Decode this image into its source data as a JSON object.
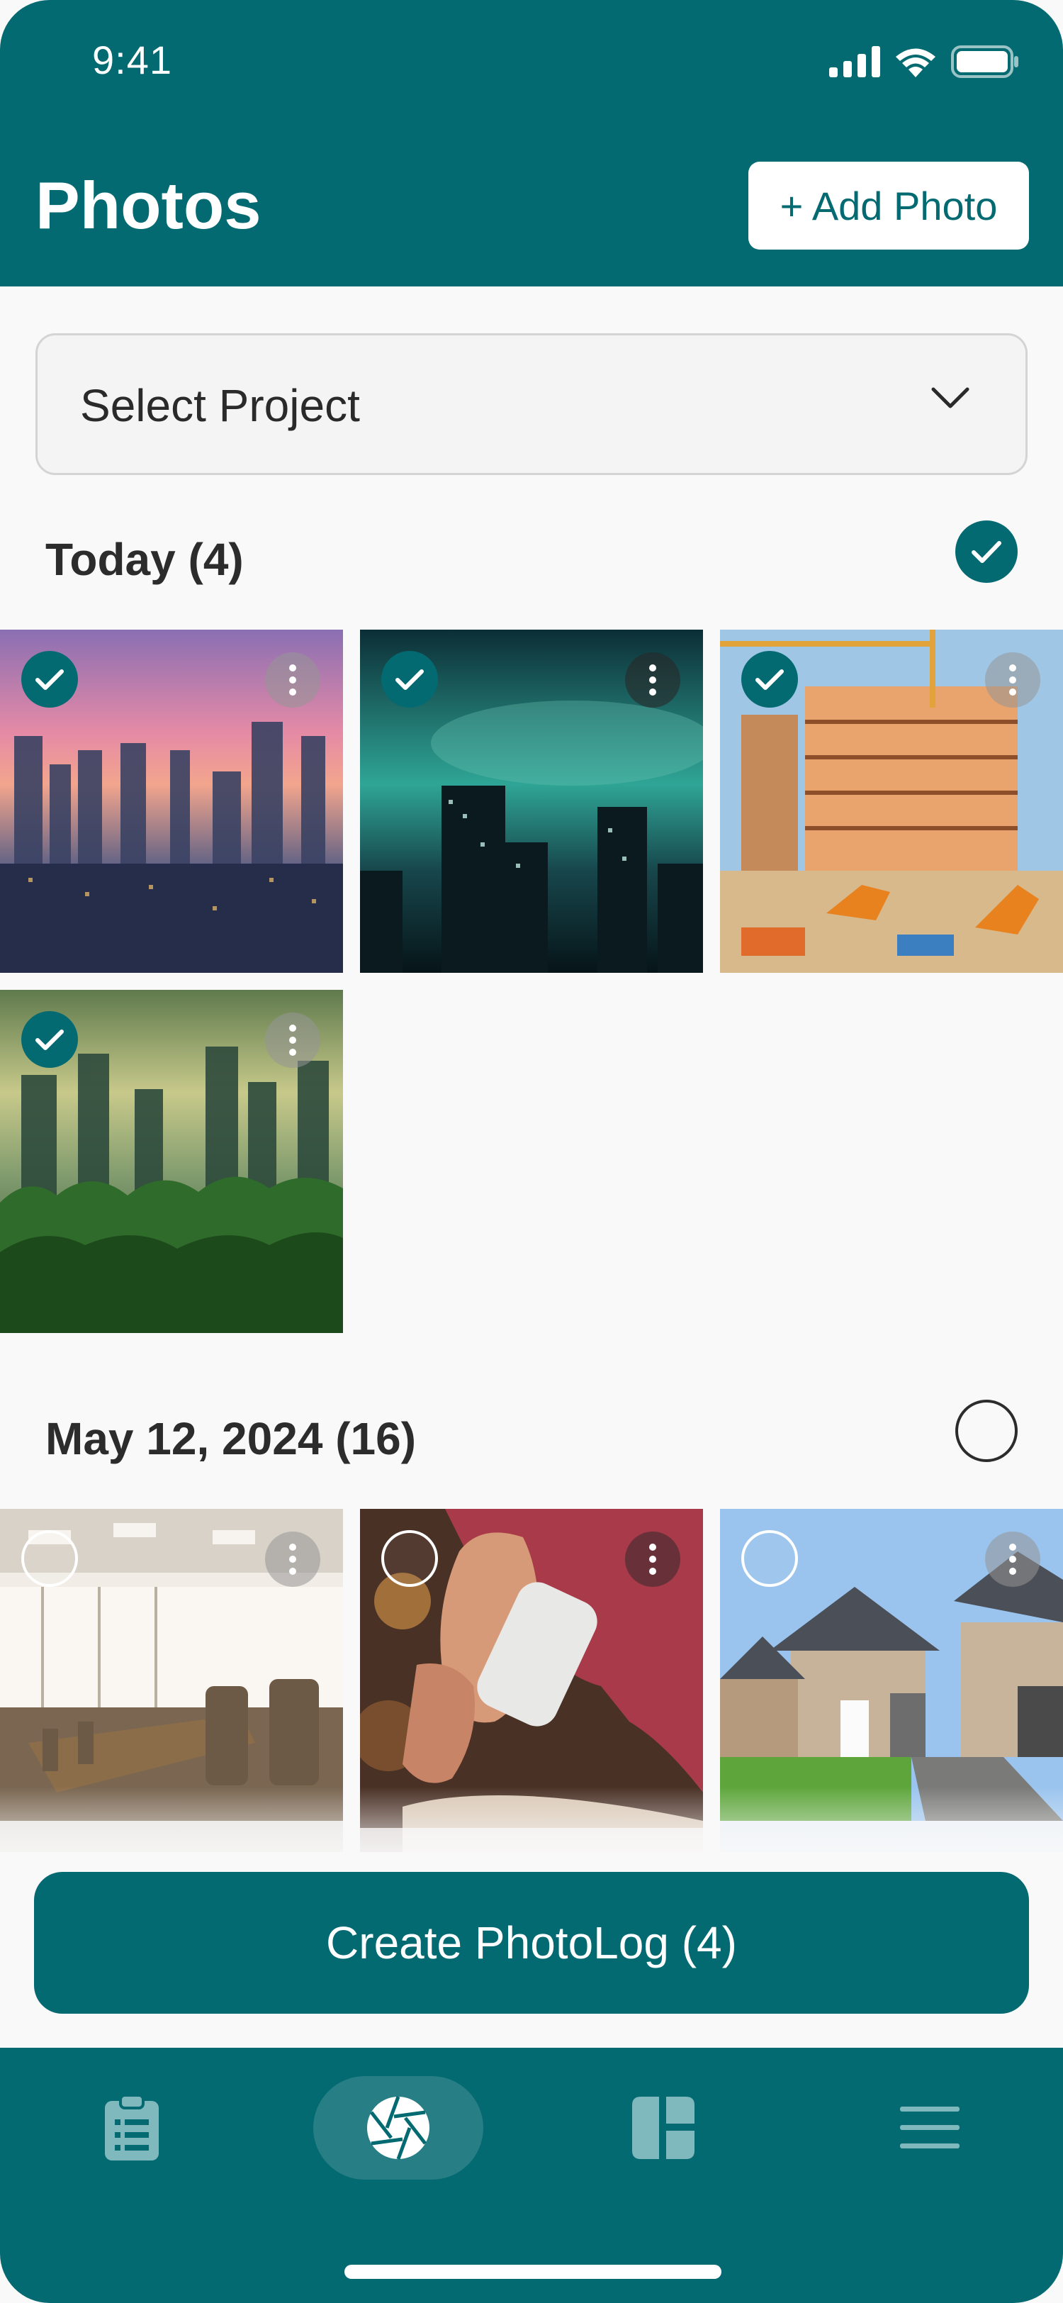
{
  "status_bar": {
    "time": "9:41"
  },
  "header": {
    "title": "Photos",
    "add_button_label": "+ Add Photo"
  },
  "project_select": {
    "label": "Select Project"
  },
  "sections": [
    {
      "title": "Today (4)",
      "all_selected": true
    },
    {
      "title": "May 12, 2024 (16)",
      "all_selected": false
    }
  ],
  "photos_today": [
    {
      "subject": "City skyline at dusk",
      "selected": true
    },
    {
      "subject": "Night skyscrapers",
      "selected": true
    },
    {
      "subject": "Construction site",
      "selected": true
    },
    {
      "subject": "Skyline above forest",
      "selected": true
    }
  ],
  "photos_may12": [
    {
      "subject": "Conference room",
      "selected": false
    },
    {
      "subject": "Woman on phone",
      "selected": false
    },
    {
      "subject": "Suburban house",
      "selected": false
    }
  ],
  "actions": {
    "create_label": "Create PhotoLog (4)"
  },
  "colors": {
    "brand": "#046a72",
    "background": "#f9f9f9"
  },
  "tab_bar": {
    "tabs": [
      {
        "icon": "clipboard-icon",
        "active": false
      },
      {
        "icon": "camera-aperture-icon",
        "active": true
      },
      {
        "icon": "dashboard-icon",
        "active": false
      },
      {
        "icon": "menu-icon",
        "active": false
      }
    ]
  }
}
